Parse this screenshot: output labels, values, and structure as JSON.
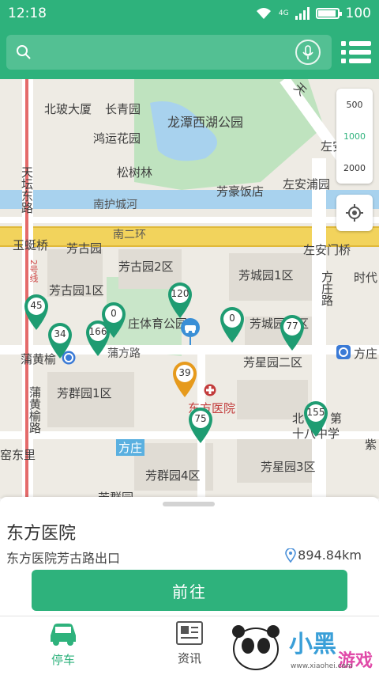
{
  "status_bar": {
    "time": "12:18",
    "battery": "100",
    "network": "4G",
    "battery_level": 0.95
  },
  "search": {
    "placeholder": "",
    "value": ""
  },
  "map": {
    "labels": {
      "beibo": "北玻大厦",
      "changqing": "长青园",
      "hongyun": "鸿运花园",
      "longtan": "龙潭西湖公园",
      "songshu": "松树林",
      "zuoan_top": "左安",
      "fanghao": "芳豪饭店",
      "zuoanpu": "左安浦园",
      "nanhu": "南护城河",
      "yuyi": "玉蜓桥",
      "nanerhuan": "南二环",
      "zuoanmen": "左安门桥",
      "fanggu": "芳古园",
      "fanggu2": "芳古园2区",
      "fangcheng1": "芳城园1区",
      "fanggu1": "芳古园1区",
      "shidai": "时代",
      "fangcheng2": "芳城园二区",
      "tiyu": "庄体育公园",
      "puhuang": "蒲黄榆",
      "pufang": "蒲方路",
      "fangxing2": "芳星园二区",
      "fangzhuang_r": "方庄",
      "fangqun1": "芳群园1区",
      "dongfang": "东方医院",
      "bei": "北",
      "bei_di": "第",
      "shiba": "十八中学",
      "fangzhuang_mid": "方庄",
      "fangqun4": "芳群园4区",
      "fangxing3": "芳星园3区",
      "kuidou": "窑东里",
      "zi": "紫",
      "tiantan": "天坛东路",
      "puhuangyu_v": "蒲黄榆路",
      "fangzhuang_v": "方庄路",
      "tiantan_n": "天",
      "fangqun_bottom": "芳群园",
      "road_2": "2号线"
    },
    "scale_options": [
      "500",
      "1000",
      "2000"
    ],
    "scale_active": "1000",
    "markers": [
      {
        "count": "45",
        "color": "#1e9c72"
      },
      {
        "count": "34",
        "color": "#1e9c72"
      },
      {
        "count": "166",
        "color": "#1e9c72"
      },
      {
        "count": "0",
        "color": "#1e9c72"
      },
      {
        "count": "120",
        "color": "#1e9c72"
      },
      {
        "count": "0",
        "color": "#1e9c72"
      },
      {
        "count": "77",
        "color": "#1e9c72"
      },
      {
        "count": "39",
        "color": "#e69a1c"
      },
      {
        "count": "75",
        "color": "#1e9c72"
      },
      {
        "count": "155",
        "color": "#1e9c72"
      }
    ]
  },
  "place": {
    "name": "东方医院",
    "address": "东方医院芳古路出口",
    "distance": "894.84km",
    "go_label": "前往"
  },
  "tabs": [
    {
      "label": "停车",
      "icon": "car-icon"
    },
    {
      "label": "资讯",
      "icon": "news-icon"
    }
  ],
  "colors": {
    "brand": "#2eb27c",
    "marker_green": "#1e9c72",
    "marker_orange": "#e69a1c"
  },
  "watermark": {
    "text": "小黑游戏",
    "url": "www.xiaohei.com"
  }
}
